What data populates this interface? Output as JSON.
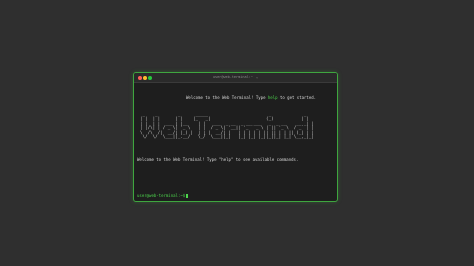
{
  "window": {
    "title": "user@web-terminal:~",
    "title_chevron": "⌄"
  },
  "terminal": {
    "welcome_prefix": "Welcome to the Web Terminal! Type ",
    "welcome_help": "help",
    "welcome_suffix": " to get started.",
    "ascii_art": " _    _        _      _____                        _             _ \n| |  | |      | |    |_   _|                      (_)           | |\n| |  | |  ___ | |__    | |   ___  _ __  _ __ ___   _  _ __    __ _| |\n| |/\\| | / _ \\| '_ \\   | |  / _ \\| '__|| '_ ` _ \\ | || '_ \\  / _` | |\n\\  /\\  /|  __/| |_) |  | | |  __/| |   | | | | | || || | | || (_| | |\n \\/  \\/  \\___||_.__/   \\_/  \\___||_|   |_| |_| |_||_||_| |_| \\__,_|_|",
    "info_line": "Welcome to the Web Terminal! Type \"help\" to see available commands.",
    "prompt": "user@web-terminal:~$"
  },
  "colors": {
    "background": "#2f2f2f",
    "terminal_bg": "#1e1e1e",
    "accent_green": "#4cd64c",
    "border_green": "#3fa63f"
  }
}
